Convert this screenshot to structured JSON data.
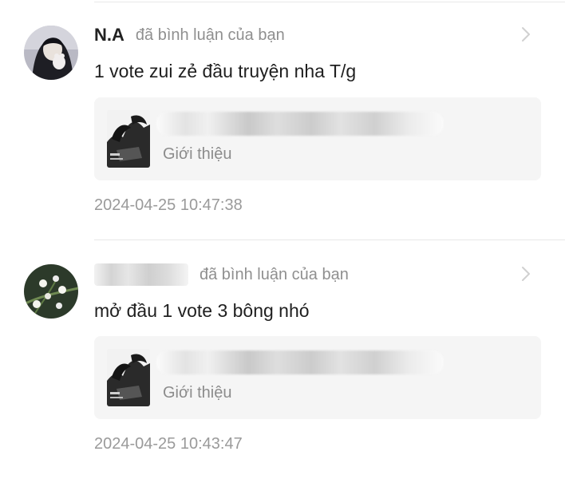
{
  "notifications": [
    {
      "user_name": "N.A",
      "action_text": "đã bình luận của bạn",
      "comment": "1 vote zui zẻ đầu truyện nha T/g",
      "card_subtitle": "Giới thiệu",
      "timestamp": "2024-04-25 10:47:38"
    },
    {
      "user_name": "",
      "action_text": "đã bình luận của bạn",
      "comment": "mở đầu 1 vote 3 bông nhó",
      "card_subtitle": "Giới thiệu",
      "timestamp": "2024-04-25 10:43:47"
    }
  ],
  "icons": {
    "chevron": "chevron-right-icon",
    "user_name_redacted": "blurred-username",
    "card_title_redacted": "blurred-story-title"
  },
  "colors": {
    "name_text": "#222222",
    "secondary_text": "#8f8f8f",
    "card_background": "#f5f5f5",
    "divider": "#e8e8e8"
  }
}
